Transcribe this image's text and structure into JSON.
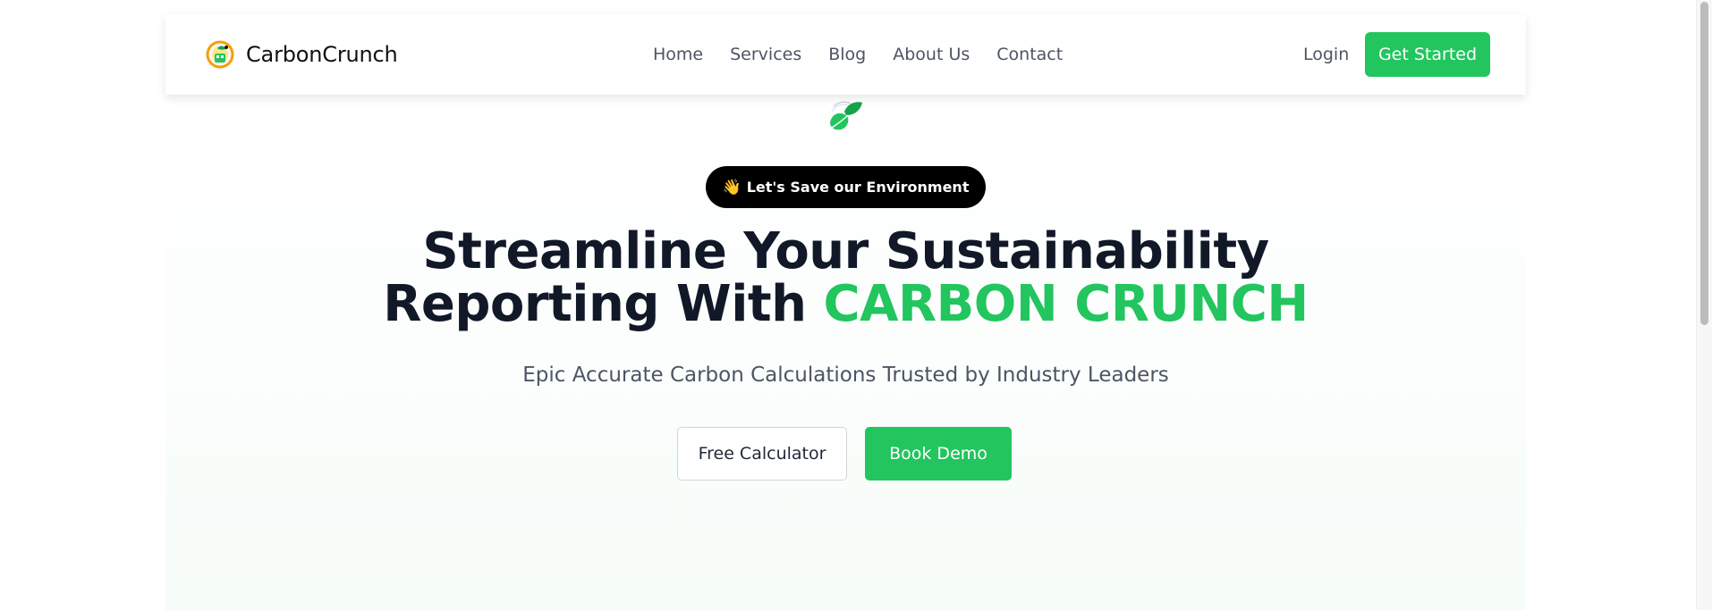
{
  "colors": {
    "accent": "#22c55e",
    "heading": "#111827",
    "muted_text": "#4b5563",
    "badge_bg": "#000000"
  },
  "navbar": {
    "brand_name": "CarbonCrunch",
    "brand_logo_icon": "leaf-logo-icon",
    "links": [
      {
        "label": "Home"
      },
      {
        "label": "Services"
      },
      {
        "label": "Blog"
      },
      {
        "label": "About Us"
      },
      {
        "label": "Contact"
      }
    ],
    "login_label": "Login",
    "cta_label": "Get Started"
  },
  "hero": {
    "leaf_icon": "leaf-icon",
    "badge_emoji": "👋",
    "badge_text": "Let's Save our Environment",
    "headline_line1": "Streamline Your Sustainability",
    "headline_line2_prefix": "Reporting With ",
    "headline_accent": "CARBON CRUNCH",
    "subheadline": "Epic Accurate Carbon Calculations Trusted by Industry Leaders",
    "secondary_button": "Free Calculator",
    "primary_button": "Book Demo"
  }
}
